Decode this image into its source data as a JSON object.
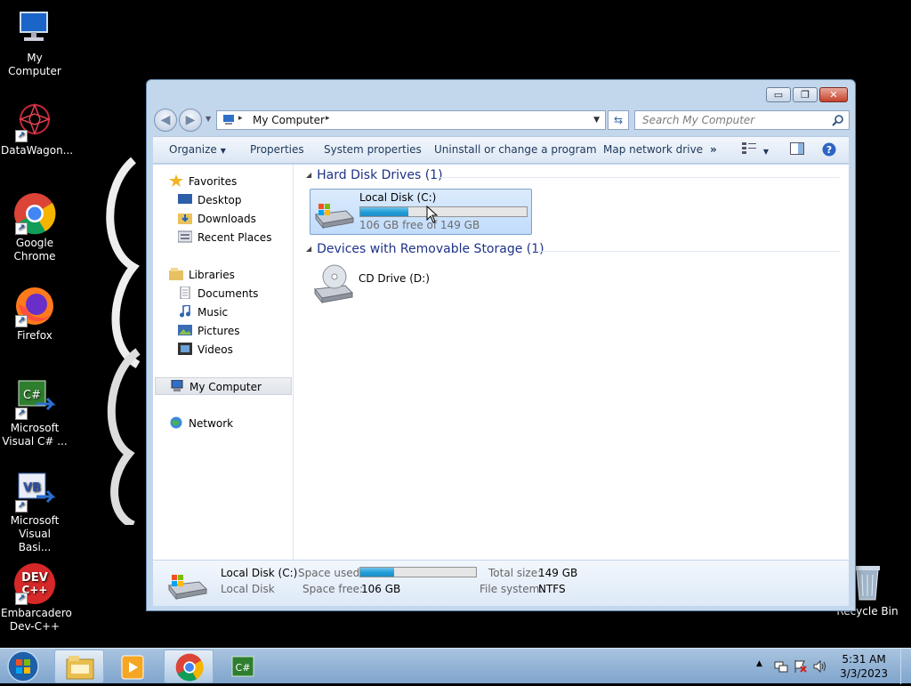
{
  "desktop": {
    "icons": [
      {
        "label": "My Computer"
      },
      {
        "label": "DataWagon..."
      },
      {
        "label": "Google Chrome"
      },
      {
        "label": "Firefox"
      },
      {
        "label": "Microsoft Visual C# ..."
      },
      {
        "label": "Microsoft Visual Basi..."
      },
      {
        "label": "Embarcadero Dev-C++"
      },
      {
        "label": "Recycle Bin"
      }
    ],
    "icon_glyphs": {
      "csharp": "C#",
      "vb": "VB",
      "dev_top": "DEV",
      "dev_bottom": "C++"
    }
  },
  "window": {
    "caption_glyphs": {
      "minimize": "▭",
      "restore": "❐",
      "close": "✕"
    },
    "address": {
      "crumb": "My Computer",
      "sep": "▸"
    },
    "search": {
      "placeholder": "Search My Computer"
    },
    "toolbar": {
      "organize": "Organize",
      "properties": "Properties",
      "system_properties": "System properties",
      "uninstall": "Uninstall or change a program",
      "map_drive": "Map network drive",
      "more": "»"
    },
    "nav": {
      "favorites": "Favorites",
      "desktop": "Desktop",
      "downloads": "Downloads",
      "recent_places": "Recent Places",
      "libraries": "Libraries",
      "documents": "Documents",
      "music": "Music",
      "pictures": "Pictures",
      "videos": "Videos",
      "my_computer": "My Computer",
      "network": "Network"
    },
    "groups": {
      "hdd": "Hard Disk Drives (1)",
      "removable": "Devices with Removable Storage (1)"
    },
    "drives": {
      "c_name": "Local Disk (C:)",
      "c_free": "106 GB free of 149 GB",
      "c_used_fraction": 0.29,
      "d_name": "CD Drive (D:)"
    },
    "details": {
      "name": "Local Disk (C:)",
      "type": "Local Disk",
      "space_used_label": "Space used:",
      "space_free_label": "Space free:",
      "space_free": "106 GB",
      "total_size_label": "Total size:",
      "total_size": "149 GB",
      "fs_label": "File system:",
      "fs": "NTFS"
    }
  },
  "taskbar": {
    "time": "5:31 AM",
    "date": "3/3/2023",
    "task_glyphs": {
      "csharp": "C#"
    }
  }
}
